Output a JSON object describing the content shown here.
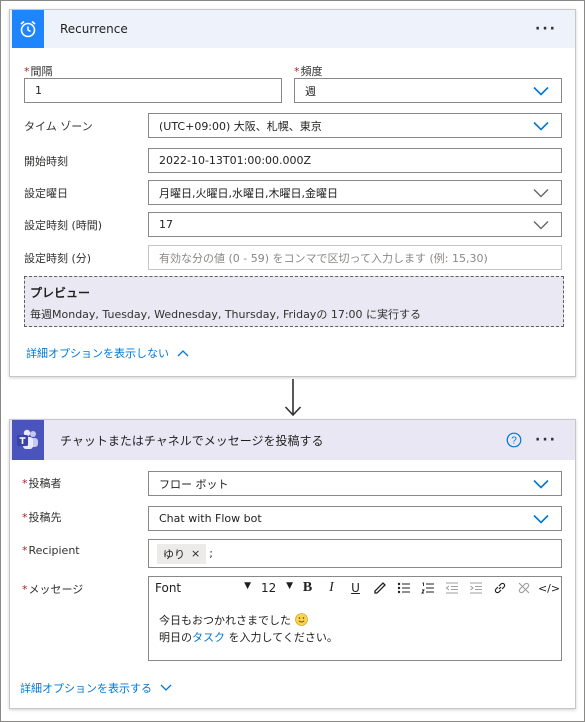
{
  "recurrence": {
    "title": "Recurrence",
    "interval_label": "間隔",
    "interval_value": "1",
    "frequency_label": "頻度",
    "frequency_value": "週",
    "timezone_label": "タイム ゾーン",
    "timezone_value": "(UTC+09:00) 大阪、札幌、東京",
    "start_label": "開始時刻",
    "start_value": "2022-10-13T01:00:00.000Z",
    "weekdays_label": "設定曜日",
    "weekdays_value": "月曜日,火曜日,水曜日,木曜日,金曜日",
    "hours_label": "設定時刻 (時間)",
    "hours_value": "17",
    "minutes_label": "設定時刻 (分)",
    "minutes_placeholder": "有効な分の値 (0 - 59) をコンマで区切って入力します (例: 15,30)",
    "preview_title": "プレビュー",
    "preview_text": "毎週Monday, Tuesday, Wednesday, Thursday, Fridayの 17:00 に実行する",
    "hide_advanced": "詳細オプションを表示しない"
  },
  "teams": {
    "title": "チャットまたはチャネルでメッセージを投稿する",
    "poster_label": "投稿者",
    "poster_value": "フロー ボット",
    "post_in_label": "投稿先",
    "post_in_value": "Chat with Flow bot",
    "recipient_label": "Recipient",
    "recipient_chip": "ゆり",
    "recipient_chip_remove": "×",
    "recipient_sep": ";",
    "message_label": "メッセージ",
    "font_value": "Font",
    "size_value": "12",
    "bold": "B",
    "italic": "I",
    "underline": "U",
    "code": "</>",
    "message_line1": "今日もおつかれさまでした",
    "message_line2_a": "明日の",
    "message_line2_link": "タスク",
    "message_line2_b": " を入力してください。",
    "show_advanced": "詳細オプションを表示する"
  },
  "colors": {
    "recurrence_header": "#eef3fb",
    "recurrence_icon_bg": "#1f85ff",
    "teams_header": "#e9e7f4",
    "teams_icon_bg": "#4b53bc",
    "link": "#0078d4",
    "required": "#a4262c"
  }
}
